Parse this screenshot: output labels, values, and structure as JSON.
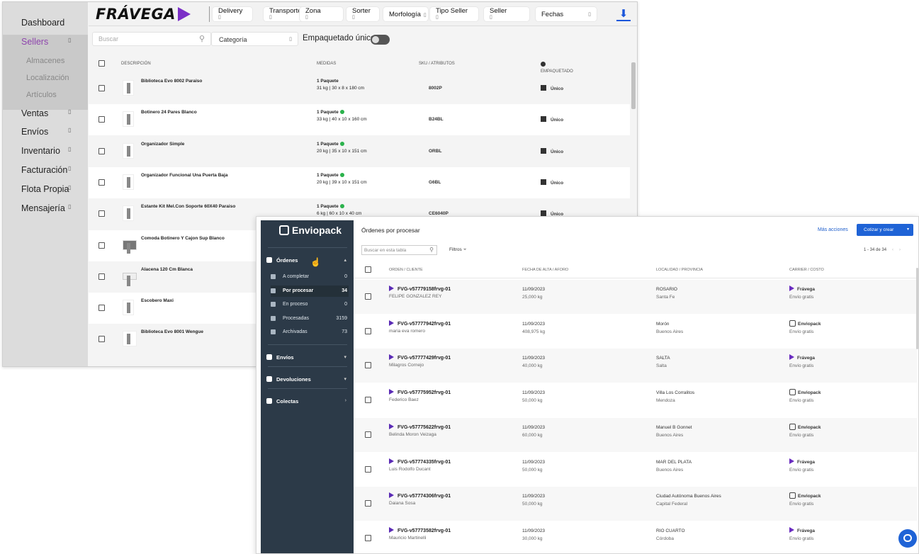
{
  "frav": {
    "sidebar": [
      {
        "label": "Dashboard",
        "chev": ""
      },
      {
        "label": "Sellers",
        "chev": "▯",
        "selected": true
      },
      {
        "label": "Almacenes",
        "sub": true
      },
      {
        "label": "Localización",
        "sub": true
      },
      {
        "label": "Artículos",
        "sub": true
      },
      {
        "label": "Ventas",
        "chev": "▯"
      },
      {
        "label": "Envíos",
        "chev": "▯"
      },
      {
        "label": "Inventario",
        "chev": "▯"
      },
      {
        "label": "Facturación",
        "chev": "▯"
      },
      {
        "label": "Flota Propia",
        "chev": "▯"
      },
      {
        "label": "Mensajería",
        "chev": "▯"
      }
    ],
    "logo": "FRÁVEGA",
    "filters": [
      "Delivery",
      "Transporte",
      "Zona",
      "Sorter",
      "Morfología",
      "Tipo Seller",
      "Seller",
      "Fechas"
    ],
    "filter_chev": "▯",
    "search_placeholder": "Buscar",
    "category": "Categoría",
    "empaquetado_label": "Empaquetado único",
    "columns": [
      "DESCRIPCIÓN",
      "MEDIDAS",
      "SKU / ATRIBUTOS",
      "EMPAQUETADO"
    ],
    "rows": [
      {
        "name": "Biblioteca Evo 8002 Paraiso",
        "paq": "1 Paquete",
        "check": false,
        "dims": "31 kg | 30 x 8 x 180 cm",
        "sku": "8002P",
        "emp": "Único"
      },
      {
        "name": "Botinero 24 Pares Blanco",
        "paq": "1 Paquete",
        "check": true,
        "dims": "33 kg | 40 x 10 x 160 cm",
        "sku": "B24BL",
        "emp": "Único"
      },
      {
        "name": "Organizador Simple",
        "paq": "1 Paquete",
        "check": true,
        "dims": "20 kg | 35 x 10 x 151 cm",
        "sku": "ORBL",
        "emp": "Único"
      },
      {
        "name": "Organizador Funcional Una Puerta Baja",
        "paq": "1 Paquete",
        "check": true,
        "dims": "20 kg | 39 x 10 x 151 cm",
        "sku": "G6BL",
        "emp": "Único"
      },
      {
        "name": "Estante Kit Mel.Con Soporte 60X40 Paraiso",
        "paq": "1 Paquete",
        "check": true,
        "dims": "6 kg | 60 x 10 x 40 cm",
        "sku": "CE6040P",
        "emp": "Único"
      },
      {
        "name": "Comoda Botinero Y Cajon Sup Blanco",
        "paq": "",
        "check": false,
        "dims": "",
        "sku": "",
        "emp": ""
      },
      {
        "name": "Alacena 120 Cm Blanca",
        "paq": "",
        "check": false,
        "dims": "",
        "sku": "",
        "emp": ""
      },
      {
        "name": "Escobero Maxi",
        "paq": "",
        "check": false,
        "dims": "",
        "sku": "",
        "emp": ""
      },
      {
        "name": "Biblioteca Evo 8001 Wengue",
        "paq": "",
        "check": false,
        "dims": "",
        "sku": "",
        "emp": ""
      }
    ]
  },
  "env": {
    "brand": "Enviopack",
    "nav_ordenes": "Órdenes",
    "subitems": [
      {
        "label": "A completar",
        "count": "0"
      },
      {
        "label": "Por procesar",
        "count": "34",
        "active": true
      },
      {
        "label": "En proceso",
        "count": "0"
      },
      {
        "label": "Procesadas",
        "count": "3159"
      },
      {
        "label": "Archivadas",
        "count": "73"
      }
    ],
    "groups": [
      {
        "label": "Envíos",
        "car": "▾"
      },
      {
        "label": "Devoluciones",
        "car": "▾"
      },
      {
        "label": "Colectas",
        "car": "›"
      }
    ],
    "title": "Órdenes por procesar",
    "more_actions": "Más acciones",
    "create_btn": "Cotizar y crear",
    "search_placeholder": "Buscar en esta tabla",
    "filters": "Filtros",
    "pagination": "1 - 34 de 34",
    "columns": [
      "ORDEN / CLIENTE",
      "FECHA DE ALTA / AFORO",
      "LOCALIDAD / PROVINCIA",
      "CARRIER / COSTO"
    ],
    "rows": [
      {
        "order": "FVG-v57779158frvg-01",
        "client": "FELIPE GONZALEZ REY",
        "date": "11/09/2023",
        "kg": "25,000 kg",
        "city": "ROSARIO",
        "prov": "Santa Fe",
        "carrier": "Frávega",
        "enviopack": false,
        "cost": "Envío gratis"
      },
      {
        "order": "FVG-v57777942frvg-01",
        "client": "maria eva romero",
        "date": "11/09/2023",
        "kg": "408,975 kg",
        "city": "Morón",
        "prov": "Buenos Aires",
        "carrier": "Enviopack",
        "enviopack": true,
        "cost": "Envío gratis"
      },
      {
        "order": "FVG-v57777429frvg-01",
        "client": "Milagros Cornejo",
        "date": "11/09/2023",
        "kg": "40,000 kg",
        "city": "SALTA",
        "prov": "Salta",
        "carrier": "Frávega",
        "enviopack": false,
        "cost": "Envío gratis"
      },
      {
        "order": "FVG-v57775952frvg-01",
        "client": "Federico Baez",
        "date": "11/09/2023",
        "kg": "50,000 kg",
        "city": "Villa Los Corralitos",
        "prov": "Mendoza",
        "carrier": "Enviopack",
        "enviopack": true,
        "cost": "Envío gratis"
      },
      {
        "order": "FVG-v57775622frvg-01",
        "client": "Belinda Moron Veizaga",
        "date": "11/09/2023",
        "kg": "60,000 kg",
        "city": "Manuel B Gonnet",
        "prov": "Buenos Aires",
        "carrier": "Enviopack",
        "enviopack": true,
        "cost": "Envío gratis"
      },
      {
        "order": "FVG-v57774335frvg-01",
        "client": "Luis Rodolfo Ducant",
        "date": "11/09/2023",
        "kg": "50,000 kg",
        "city": "MAR DEL PLATA",
        "prov": "Buenos Aires",
        "carrier": "Frávega",
        "enviopack": false,
        "cost": "Envío gratis"
      },
      {
        "order": "FVG-v57774306frvg-01",
        "client": "Daiana Sosa",
        "date": "11/09/2023",
        "kg": "50,000 kg",
        "city": "Ciudad Autónoma Buenos Aires",
        "prov": "Capital Federal",
        "carrier": "Enviopack",
        "enviopack": true,
        "cost": "Envío gratis"
      },
      {
        "order": "FVG-v57773582frvg-01",
        "client": "Mauricio Martinelli",
        "date": "11/09/2023",
        "kg": "30,000 kg",
        "city": "RIO CUARTO",
        "prov": "Córdoba",
        "carrier": "Frávega",
        "enviopack": false,
        "cost": "Envío gratis"
      }
    ]
  },
  "colors": {
    "accent": "#7b2fc7",
    "primary": "#1f63d6",
    "sidebar_dark": "#2c3a48",
    "check": "#2bb24c"
  }
}
